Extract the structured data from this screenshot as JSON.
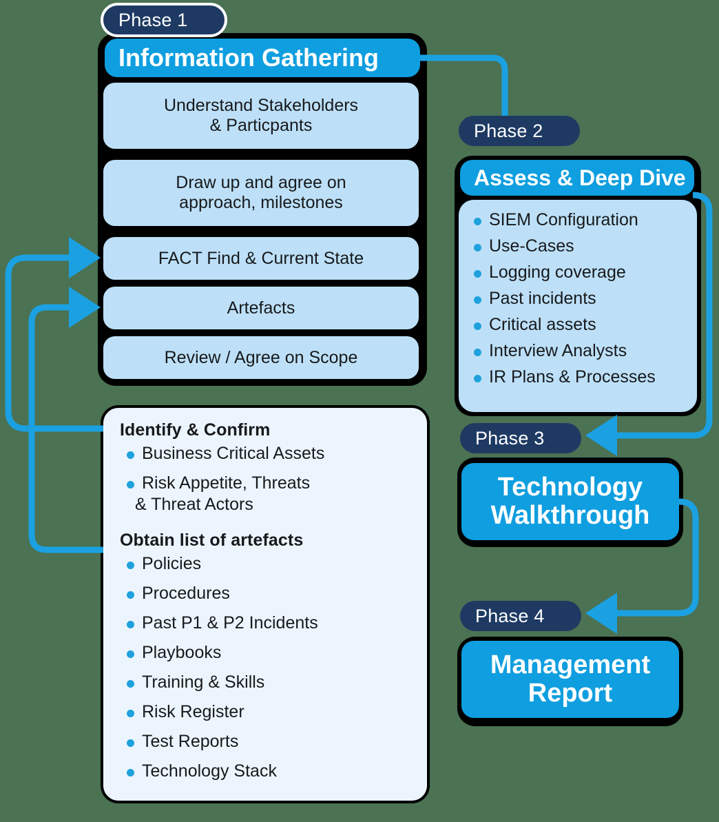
{
  "colors": {
    "background": "#4a7253",
    "phase_pill": "#1e3a63",
    "header_blue": "#0f9edf",
    "chip_blue": "#bde0f8",
    "panel_white": "#ecf5fd",
    "bullet": "#1ea1dc",
    "connector": "#1ba1e2",
    "outline": "#000000"
  },
  "phase1": {
    "pill": "Phase 1",
    "header": "Information Gathering",
    "steps": [
      "Understand Stakeholders\n& Particpants",
      "Draw up and agree on\napproach, milestones",
      "FACT Find & Current State",
      "Artefacts",
      "Review / Agree on Scope"
    ],
    "step0_line1": "Understand Stakeholders",
    "step0_line2": "& Particpants",
    "step1_line1": "Draw up and agree on",
    "step1_line2": "approach, milestones",
    "step2": "FACT Find & Current State",
    "step3": "Artefacts",
    "step4": "Review / Agree on Scope"
  },
  "details_panel": {
    "group1_title": "Identify & Confirm",
    "group1_items": [
      "Business Critical Assets",
      "Risk Appetite, Threats",
      "& Threat Actors"
    ],
    "group1_item0": "Business Critical Assets",
    "group1_item1": "Risk Appetite, Threats",
    "group1_item1_cont": "& Threat Actors",
    "group2_title": "Obtain list of artefacts",
    "group2_items": [
      "Policies",
      "Procedures",
      "Past P1 & P2 Incidents",
      "Playbooks",
      "Training & Skills",
      "Risk Register",
      "Test Reports",
      "Technology Stack"
    ]
  },
  "phase2": {
    "pill": "Phase 2",
    "header": "Assess & Deep Dive",
    "items": [
      "SIEM Configuration",
      "Use-Cases",
      "Logging coverage",
      "Past incidents",
      "Critical assets",
      "Interview Analysts",
      "IR Plans & Processes"
    ]
  },
  "phase3": {
    "pill": "Phase 3",
    "header_line1": "Technology",
    "header_line2": "Walkthrough"
  },
  "phase4": {
    "pill": "Phase 4",
    "header_line1": "Management",
    "header_line2": "Report"
  }
}
